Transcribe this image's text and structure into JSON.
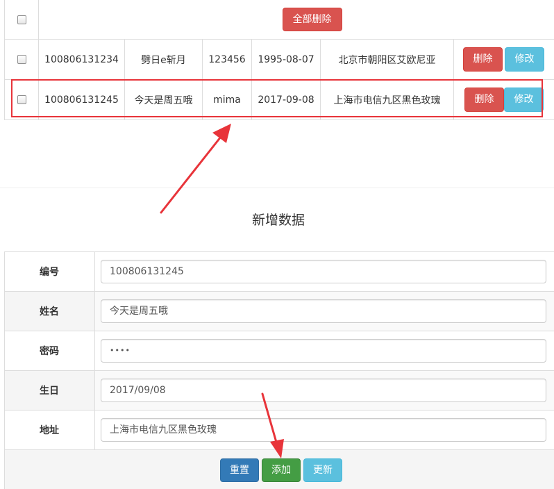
{
  "table": {
    "delete_all_label": "全部删除",
    "rows": [
      {
        "id": "100806131234",
        "name": "劈日e斩月",
        "password": "123456",
        "birthday": "1995-08-07",
        "address": "北京市朝阳区艾欧尼亚",
        "delete_label": "删除",
        "edit_label": "修改"
      },
      {
        "id": "100806131245",
        "name": "今天是周五哦",
        "password": "mima",
        "birthday": "2017-09-08",
        "address": "上海市电信九区黑色玫瑰",
        "delete_label": "删除",
        "edit_label": "修改"
      }
    ]
  },
  "form": {
    "title": "新增数据",
    "fields": {
      "id": {
        "label": "编号",
        "value": "100806131245"
      },
      "name": {
        "label": "姓名",
        "value": "今天是周五哦"
      },
      "password": {
        "label": "密码",
        "value": "••••"
      },
      "birthday": {
        "label": "生日",
        "value": "2017/09/08"
      },
      "address": {
        "label": "地址",
        "value": "上海市电信九区黑色玫瑰"
      }
    },
    "buttons": {
      "reset": "重置",
      "add": "添加",
      "update": "更新"
    }
  },
  "colors": {
    "danger": "#d9534f",
    "info": "#5bc0de",
    "primary": "#337ab7",
    "success": "#449d44",
    "annotation": "#e8343a"
  }
}
